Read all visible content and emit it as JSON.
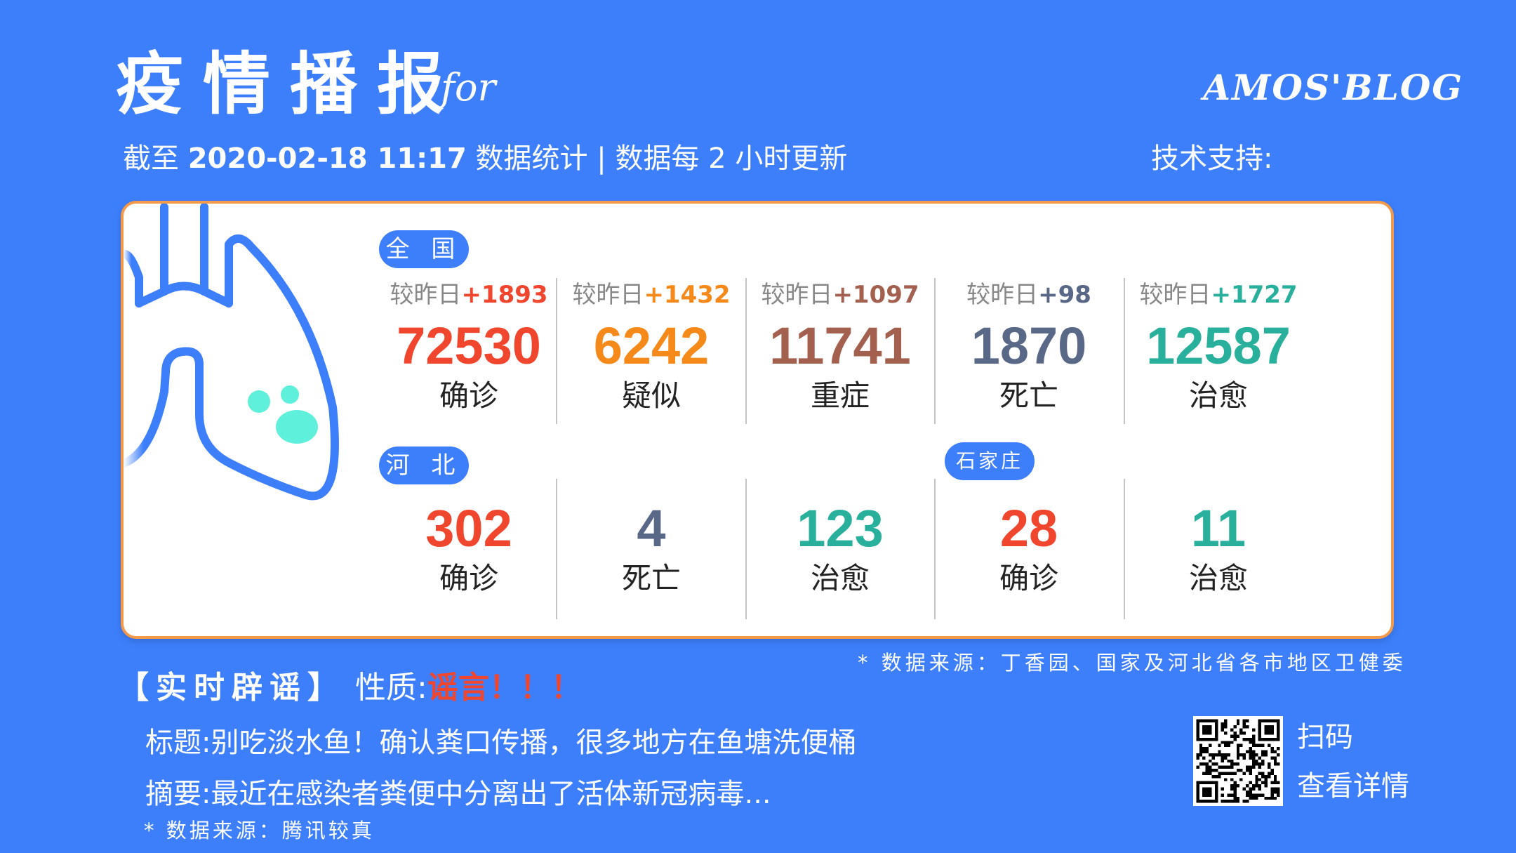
{
  "header": {
    "title": "疫情播报",
    "title_suffix": "for",
    "blog_name": "AMOS'BLOG",
    "as_of_prefix": "截至",
    "datetime": "2020-02-18 11:17",
    "stat_note": "数据统计 |  数据每 2 小时更新",
    "tech_support": "技术支持:"
  },
  "national": {
    "badge": "全 国",
    "compare_prefix": "较昨日",
    "items": [
      {
        "delta": "+1893",
        "value": "72530",
        "label": "确诊",
        "color": "#f0462e"
      },
      {
        "delta": "+1432",
        "value": "6242",
        "label": "疑似",
        "color": "#f5891a"
      },
      {
        "delta": "+1097",
        "value": "11741",
        "label": "重症",
        "color": "#a4604e"
      },
      {
        "delta": "+98",
        "value": "1870",
        "label": "死亡",
        "color": "#5a6887"
      },
      {
        "delta": "+1727",
        "value": "12587",
        "label": "治愈",
        "color": "#28b09c"
      }
    ]
  },
  "province": {
    "badge": "河 北",
    "items": [
      {
        "value": "302",
        "label": "确诊",
        "color": "#f0462e"
      },
      {
        "value": "4",
        "label": "死亡",
        "color": "#5a6887"
      },
      {
        "value": "123",
        "label": "治愈",
        "color": "#28b09c"
      }
    ]
  },
  "city": {
    "badge": "石家庄",
    "items": [
      {
        "value": "28",
        "label": "确诊",
        "color": "#f0462e"
      },
      {
        "value": "11",
        "label": "治愈",
        "color": "#28b09c"
      }
    ]
  },
  "data_source": "* 数据来源：丁香园、国家及河北省各市地区卫健委",
  "rumor": {
    "section_label": "【实时辟谣】",
    "nature_label": "性质:",
    "verdict": "谣言！！！",
    "title_label": "标题:",
    "title": "别吃淡水鱼！确认粪口传播，很多地方在鱼塘洗便桶",
    "summary_label": "摘要:",
    "summary": "最近在感染者粪便中分离出了活体新冠病毒...",
    "source": "* 数据来源：腾讯较真"
  },
  "qr": {
    "line1": "扫码",
    "line2": "查看详情",
    "icon": "qr-code-icon"
  },
  "colors": {
    "background": "#3d7ffb",
    "card_border": "#f3994a"
  }
}
